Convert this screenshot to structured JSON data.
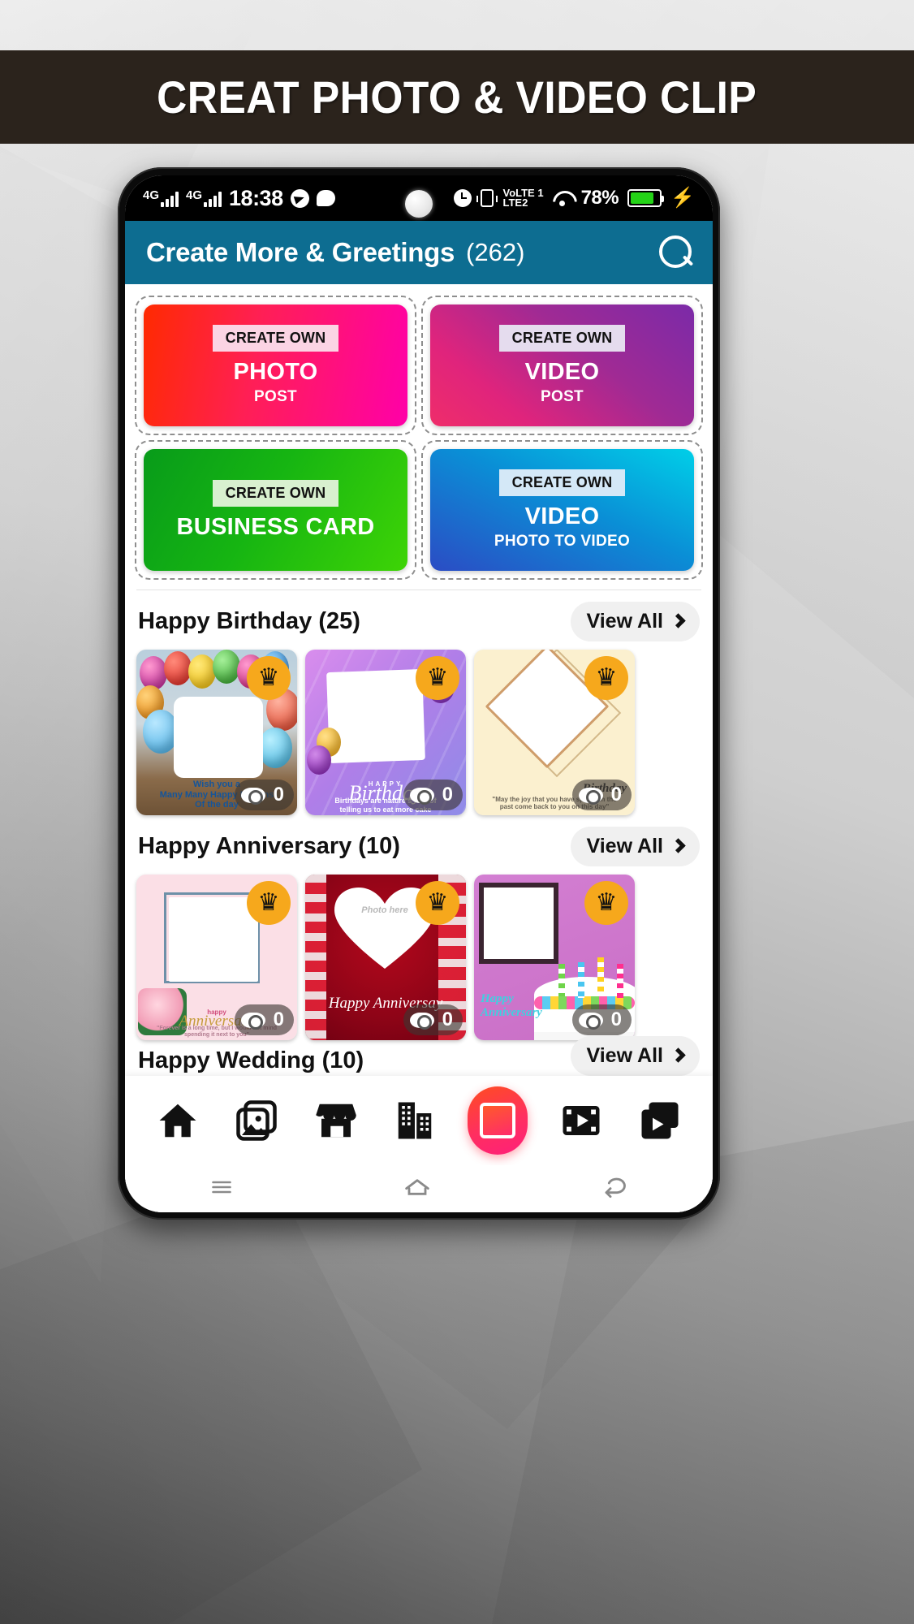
{
  "banner": {
    "text": "CREAT PHOTO & VIDEO CLIP",
    "bg_color": "#2b231c",
    "text_color": "#ffffff"
  },
  "status_bar": {
    "network_1": "4G",
    "network_2": "4G",
    "time": "18:38",
    "volte": "VoLTE2",
    "volte_line1": "VoLTE 1",
    "volte_line2": "LTE2",
    "battery_percent": "78%",
    "charging_icon": "⚡",
    "icons": [
      "signal-icon",
      "signal-icon",
      "telegram-icon",
      "message-icon",
      "alarm-icon",
      "vibrate-icon",
      "volte-icon",
      "wifi-icon",
      "battery-icon",
      "charging-bolt-icon"
    ]
  },
  "app_bar": {
    "title": "Create More & Greetings",
    "count": "(262)",
    "search_icon": "search-icon",
    "bg_color": "#0d6d91"
  },
  "create_cards": [
    {
      "chip": "CREATE OWN",
      "title": "PHOTO",
      "subtitle": "POST",
      "accent": "#ff1f55"
    },
    {
      "chip": "CREATE OWN",
      "title": "VIDEO",
      "subtitle": "POST",
      "accent": "#a02a94"
    },
    {
      "chip": "CREATE OWN",
      "title": "BUSINESS CARD",
      "subtitle": "",
      "accent": "#16b512"
    },
    {
      "chip": "CREATE OWN",
      "title": "VIDEO",
      "subtitle": "PHOTO TO VIDEO",
      "accent": "#0a8fd6"
    }
  ],
  "sections": [
    {
      "title": "Happy Birthday (25)",
      "view_all": "View All",
      "tiles": [
        {
          "caption": "Wish you a\nMany Many Happy Returns\nOf the day",
          "views": "0",
          "badge": "crown-icon"
        },
        {
          "caption": "Birthdays are nature's way of\ntelling us to eat more cake",
          "title_script": "Birthday",
          "title_small": "HAPPY",
          "views": "0",
          "badge": "crown-icon"
        },
        {
          "caption": "\"May the joy that you have spread in the\npast come back to you on this day\"",
          "title_script": "Birthday",
          "title_small": "Happy",
          "views": "0",
          "badge": "crown-icon"
        }
      ]
    },
    {
      "title": "Happy Anniversary (10)",
      "view_all": "View All",
      "tiles": [
        {
          "caption": "\"Forever is a long time, but I would not mind\nspending it next to you\"",
          "title_script": "Anniversary",
          "title_small": "happy",
          "views": "0",
          "badge": "crown-icon"
        },
        {
          "caption": "Photo here",
          "title_script": "Happy Anniversay",
          "views": "0",
          "badge": "crown-icon"
        },
        {
          "caption": "",
          "title_script": "Happy Anniversary",
          "views": "0",
          "badge": "crown-icon"
        }
      ]
    }
  ],
  "cut_section": {
    "title": "Happy Wedding (10)",
    "view_all": "View All"
  },
  "bottom_nav": {
    "items": [
      {
        "icon": "home-icon",
        "active": false
      },
      {
        "icon": "gallery-icon",
        "active": false
      },
      {
        "icon": "store-icon",
        "active": false
      },
      {
        "icon": "buildings-icon",
        "active": false
      },
      {
        "icon": "frame-icon",
        "active": true
      },
      {
        "icon": "video-player-icon",
        "active": false
      },
      {
        "icon": "video-library-icon",
        "active": false
      }
    ]
  },
  "system_nav": {
    "items": [
      "menu-icon",
      "home-icon",
      "back-icon"
    ]
  }
}
